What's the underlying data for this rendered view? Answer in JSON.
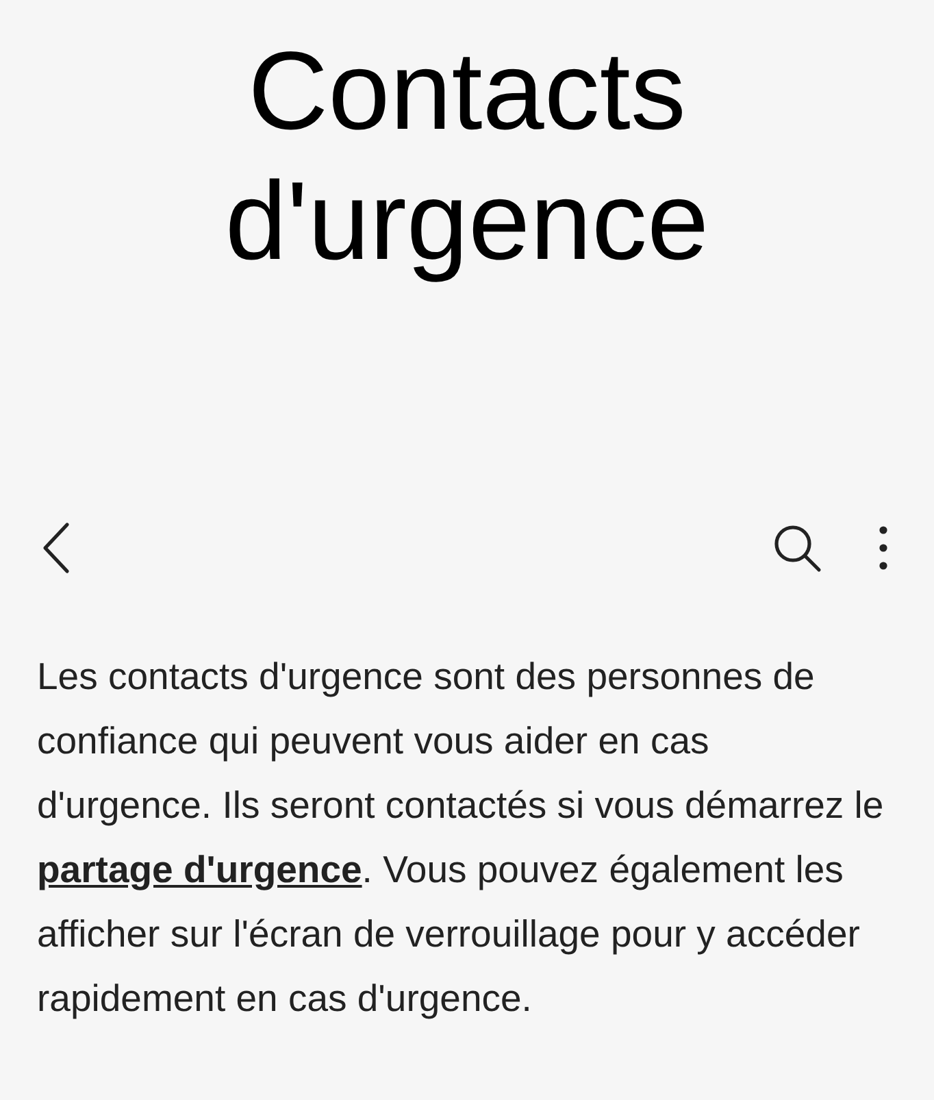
{
  "header": {
    "title": "Contacts d'urgence"
  },
  "toolbar": {
    "buttons": [
      {
        "kind": "back"
      },
      {
        "kind": "spacer"
      },
      {
        "kind": "search"
      },
      {
        "kind": "more"
      }
    ]
  },
  "description": {
    "text_before": "Les contacts d'urgence sont des personnes de confiance qui peuvent vous aider en cas d'urgence. Ils seront contactés si vous démarrez le ",
    "link": "partage d'urgence",
    "text_after": ". Vous pouvez également les afficher sur l'écran de verrouillage pour y accéder rapidement en cas d'urgence."
  }
}
